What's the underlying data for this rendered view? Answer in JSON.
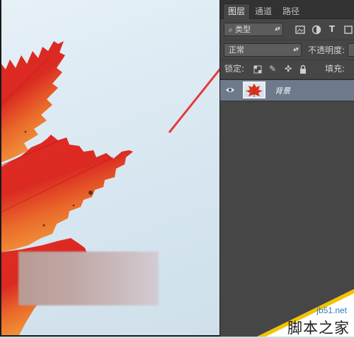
{
  "panel": {
    "tabs": [
      {
        "label": "图层",
        "active": true
      },
      {
        "label": "通道",
        "active": false
      },
      {
        "label": "路径",
        "active": false
      }
    ],
    "filter": {
      "kind_label": "类型",
      "search_icon": "search-icon"
    },
    "blend_mode": "正常",
    "opacity_label": "不透明度:",
    "lock_label": "锁定:",
    "fill_label": "填充:",
    "layers": [
      {
        "name": "背景",
        "visible": true,
        "selected": true
      }
    ]
  },
  "colors": {
    "panel_bg": "#464646",
    "tab_bar_bg": "#323232",
    "selected_layer": "#6e7a8c",
    "arrow_red": "#e53a3a",
    "leaf_red": "#d8231f",
    "leaf_orange": "#ef8a2a"
  },
  "watermark": {
    "url": "jb51.net",
    "name": "脚本之家"
  }
}
